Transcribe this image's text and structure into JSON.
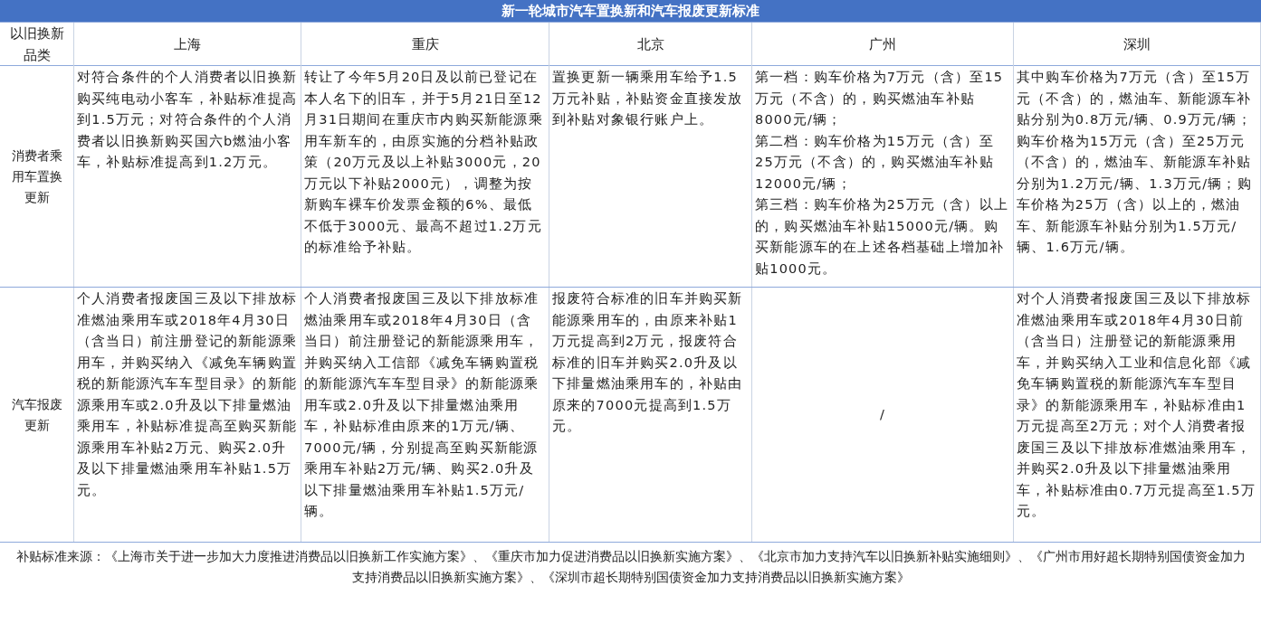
{
  "title": "新一轮城市汽车置换新和汽车报废更新标准",
  "columns": [
    "以旧换新品类",
    "上海",
    "重庆",
    "北京",
    "广州",
    "深圳"
  ],
  "rows": [
    {
      "category": "消费者乘用车置换更新",
      "cells": [
        "对符合条件的个人消费者以旧换新购买纯电动小客车，补贴标准提高到1.5万元；对符合条件的个人消费者以旧换新购买国六b燃油小客车，补贴标准提高到1.2万元。",
        "转让了今年5月20日及以前已登记在本人名下的旧车，并于5月21日至12月31日期间在重庆市内购买新能源乘用车新车的，由原实施的分档补贴政策（20万元及以上补贴3000元，20万元以下补贴2000元），调整为按新购车裸车价发票金额的6%、最低不低于3000元、最高不超过1.2万元的标准给予补贴。",
        "置换更新一辆乘用车给予1.5万元补贴，补贴资金直接发放到补贴对象银行账户上。",
        [
          "第一档：购车价格为7万元（含）至15万元（不含）的，购买燃油车补贴8000元/辆；",
          "第二档：购车价格为15万元（含）至25万元（不含）的，购买燃油车补贴12000元/辆；",
          "第三档：购车价格为25万元（含）以上的，购买燃油车补贴15000元/辆。购买新能源车的在上述各档基础上增加补贴1000元。"
        ],
        "其中购车价格为7万元（含）至15万元（不含）的，燃油车、新能源车补贴分别为0.8万元/辆、0.9万元/辆；购车价格为15万元（含）至25万元（不含）的，燃油车、新能源车补贴分别为1.2万元/辆、1.3万元/辆；购车价格为25万（含）以上的，燃油车、新能源车补贴分别为1.5万元/辆、1.6万元/辆。"
      ]
    },
    {
      "category": "汽车报废更新",
      "cells": [
        "个人消费者报废国三及以下排放标准燃油乘用车或2018年4月30日（含当日）前注册登记的新能源乘用车，并购买纳入《减免车辆购置税的新能源汽车车型目录》的新能源乘用车或2.0升及以下排量燃油乘用车，补贴标准提高至购买新能源乘用车补贴2万元、购买2.0升及以下排量燃油乘用车补贴1.5万元。",
        "个人消费者报废国三及以下排放标准燃油乘用车或2018年4月30日（含当日）前注册登记的新能源乘用车，并购买纳入工信部《减免车辆购置税的新能源汽车车型目录》的新能源乘用车或2.0升及以下排量燃油乘用车，补贴标准由原来的1万元/辆、7000元/辆，分别提高至购买新能源乘用车补贴2万元/辆、购买2.0升及以下排量燃油乘用车补贴1.5万元/辆。",
        "报废符合标准的旧车并购买新能源乘用车的，由原来补贴1万元提高到2万元，报废符合标准的旧车并购买2.0升及以下排量燃油乘用车的，补贴由原来的7000元提高到1.5万元。",
        "/",
        "对个人消费者报废国三及以下排放标准燃油乘用车或2018年4月30日前（含当日）注册登记的新能源乘用车，并购买纳入工业和信息化部《减免车辆购置税的新能源汽车车型目录》的新能源乘用车，补贴标准由1万元提高至2万元；对个人消费者报废国三及以下排放标准燃油乘用车，并购买2.0升及以下排量燃油乘用车，补贴标准由0.7万元提高至1.5万元。"
      ]
    }
  ],
  "footer": "补贴标准来源：《上海市关于进一步加大力度推进消费品以旧换新工作实施方案》、《重庆市加力促进消费品以旧换新实施方案》、《北京市加力支持汽车以旧换新补贴实施细则》、《广州市用好超长期特别国债资金加力支持消费品以旧换新实施方案》、《深圳市超长期特别国债资金加力支持消费品以旧换新实施方案》"
}
